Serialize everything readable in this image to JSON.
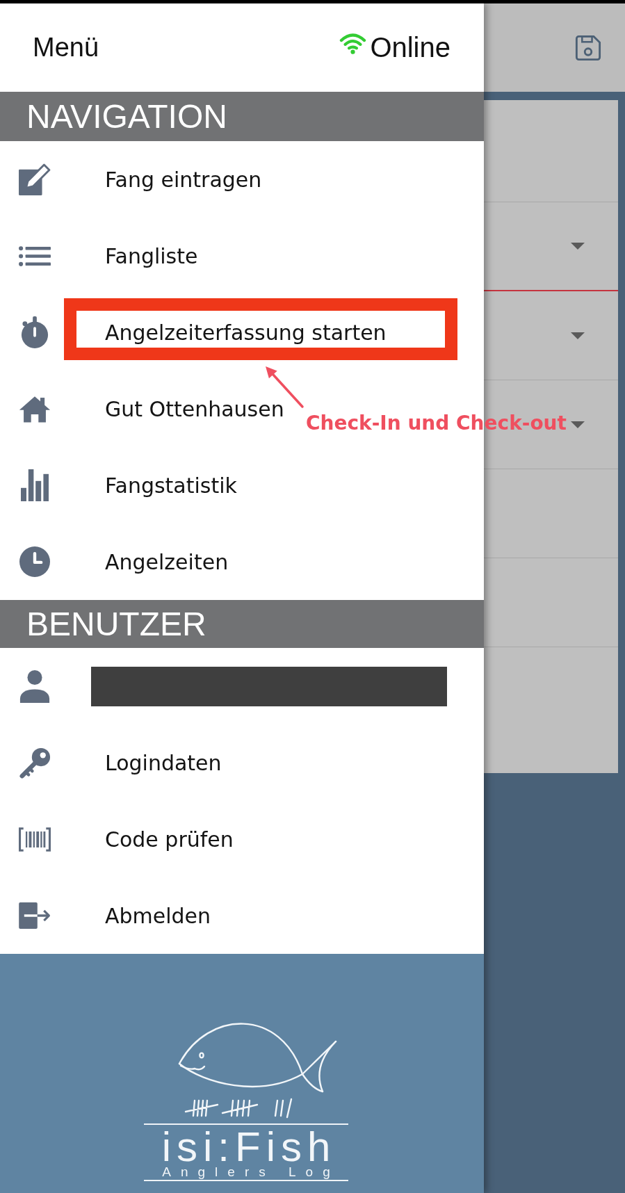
{
  "header": {
    "title": "Menü",
    "connection": {
      "label": "Online",
      "online": true
    }
  },
  "navigation": {
    "title": "NAVIGATION",
    "items": [
      {
        "label": "Fang eintragen",
        "highlighted": false
      },
      {
        "label": "Fangliste",
        "highlighted": false
      },
      {
        "label": "Angelzeiterfassung starten",
        "highlighted": true
      },
      {
        "label": "Gut Ottenhausen",
        "highlighted": false
      },
      {
        "label": "Fangstatistik",
        "highlighted": false
      },
      {
        "label": "Angelzeiten",
        "highlighted": false
      }
    ]
  },
  "annotation": {
    "text": "Check-In und Check-out"
  },
  "user": {
    "title": "BENUTZER",
    "items": [
      {
        "kind": "redacted"
      },
      {
        "kind": "link",
        "label": "Logindaten"
      },
      {
        "kind": "link",
        "label": "Code prüfen"
      },
      {
        "kind": "link",
        "label": "Abmelden"
      }
    ]
  },
  "logo": {
    "name": "isi:Fish",
    "tagline": "Anglers Log"
  },
  "background_form": {
    "fields": [
      {
        "kind": "text",
        "focused": false
      },
      {
        "kind": "dropdown",
        "focused": true
      },
      {
        "kind": "dropdown",
        "focused": false
      },
      {
        "kind": "dropdown",
        "focused": false
      },
      {
        "kind": "text",
        "focused": false
      },
      {
        "kind": "text",
        "focused": false
      }
    ]
  }
}
